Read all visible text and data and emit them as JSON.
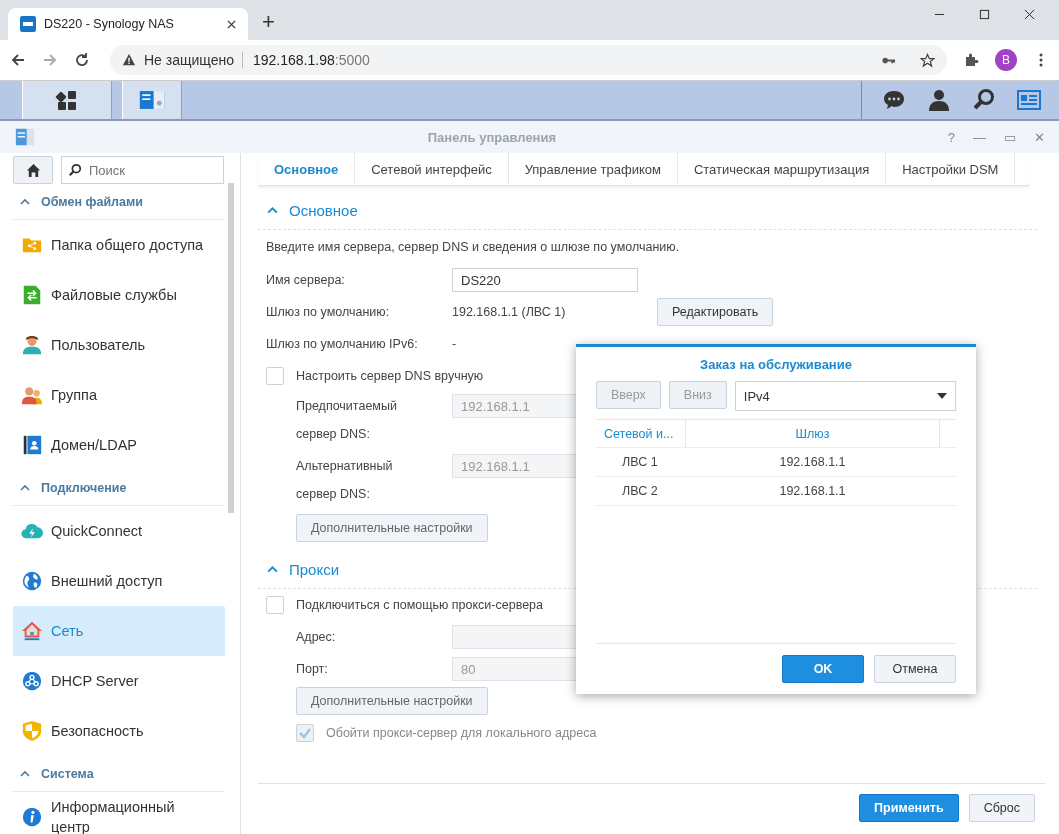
{
  "browser": {
    "tab_title": "DS220 - Synology NAS",
    "new_tab": "+",
    "security": "Не защищено",
    "url_host": "192.168.1.98",
    "url_port": ":5000",
    "profile": "B"
  },
  "window": {
    "title": "Панель управления",
    "controls": [
      "?",
      "—",
      "▭",
      "✕"
    ]
  },
  "sidebar": {
    "search": {
      "placeholder": "Поиск"
    },
    "groups": [
      {
        "title": "Обмен файлами",
        "expanded": true,
        "items": [
          {
            "label": "Папка общего доступа",
            "kind": "share",
            "selected": false
          },
          {
            "label": "Файловые службы",
            "kind": "file",
            "selected": false
          },
          {
            "label": "Пользователь",
            "kind": "user",
            "selected": false
          },
          {
            "label": "Группа",
            "kind": "group",
            "selected": false
          },
          {
            "label": "Домен/LDAP",
            "kind": "domain",
            "selected": false
          }
        ]
      },
      {
        "title": "Подключение",
        "expanded": true,
        "items": [
          {
            "label": "QuickConnect",
            "kind": "cloud",
            "selected": false
          },
          {
            "label": "Внешний доступ",
            "kind": "globe",
            "selected": false
          },
          {
            "label": "Сеть",
            "kind": "network",
            "selected": true
          },
          {
            "label": "DHCP Server",
            "kind": "dhcp",
            "selected": false
          },
          {
            "label": "Безопасность",
            "kind": "shield",
            "selected": false
          }
        ]
      },
      {
        "title": "Система",
        "expanded": true,
        "items": [
          {
            "label": "Информационный центр",
            "kind": "info",
            "selected": false
          }
        ]
      }
    ]
  },
  "tabs": [
    {
      "label": "Основное",
      "selected": true
    },
    {
      "label": "Сетевой интерфейс",
      "selected": false
    },
    {
      "label": "Управление трафиком",
      "selected": false
    },
    {
      "label": "Статическая маршрутизация",
      "selected": false
    },
    {
      "label": "Настройки DSM",
      "selected": false
    }
  ],
  "general": {
    "title": "Основное",
    "expanded": true,
    "description": "Введите имя сервера, сервер DNS и сведения о шлюзе по умолчанию.",
    "server_name": {
      "label": "Имя сервера:",
      "value": "DS220"
    },
    "gateway": {
      "label": "Шлюз по умолчанию:",
      "value": "192.168.1.1 (ЛВС 1)",
      "button": "Редактировать"
    },
    "gateway_v6": {
      "label": "Шлюз по умолчанию IPv6:",
      "value": "-"
    },
    "dns_manual": {
      "label": "Настроить сервер DNS вручную",
      "checked": false
    },
    "preferred_dns": {
      "label": [
        "Предпочитаемый",
        "сервер DNS:"
      ],
      "value": "192.168.1.1"
    },
    "alternate_dns": {
      "label": [
        "Альтернативный",
        "сервер DNS:"
      ],
      "value": "192.168.1.1"
    },
    "advanced_button": "Дополнительные настройки"
  },
  "proxy": {
    "title": "Прокси",
    "expanded": true,
    "use_proxy": {
      "label": "Подключиться с помощью прокси-сервера",
      "checked": false
    },
    "address": {
      "label": "Адрес:"
    },
    "port": {
      "label": "Порт:",
      "value": "80"
    },
    "advanced_button": "Дополнительные настройки",
    "bypass_local": {
      "label": "Обойти прокси-сервер для локального адреса",
      "checked": true,
      "disabled": true
    }
  },
  "footer": {
    "apply": "Применить",
    "reset": "Сброс"
  },
  "dialog": {
    "title": "Заказ на обслуживание",
    "up": {
      "label": "Вверх",
      "disabled": true
    },
    "down": {
      "label": "Вниз",
      "disabled": true
    },
    "protocol": "IPv4",
    "columns": [
      "Сетевой и...",
      "Шлюз"
    ],
    "rows": [
      [
        "ЛВС 1",
        "192.168.1.1"
      ],
      [
        "ЛВС 2",
        "192.168.1.1"
      ]
    ],
    "ok": "OK",
    "cancel": "Отмена"
  }
}
